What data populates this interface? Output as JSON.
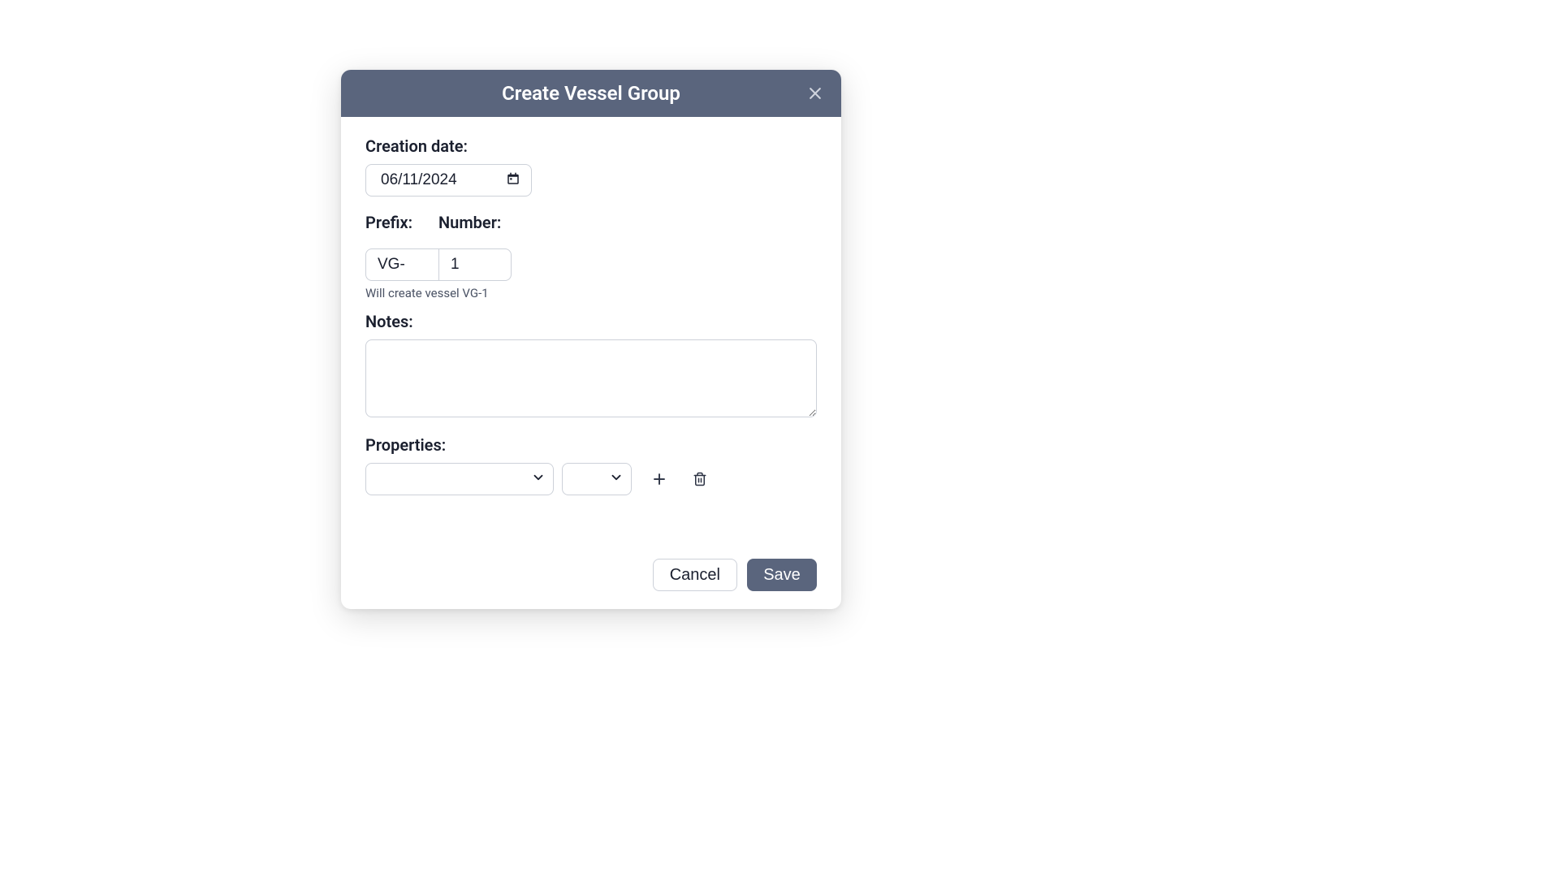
{
  "modal": {
    "title": "Create Vessel Group",
    "labels": {
      "creation_date": "Creation date:",
      "prefix": "Prefix:",
      "number": "Number:",
      "notes": "Notes:",
      "properties": "Properties:"
    },
    "fields": {
      "creation_date": "06/11/2024",
      "prefix": "VG-",
      "number": "1",
      "notes": "",
      "property_key": "",
      "property_value": ""
    },
    "hint": "Will create vessel VG-1",
    "buttons": {
      "cancel": "Cancel",
      "save": "Save"
    }
  },
  "colors": {
    "header_bg": "#5a657d",
    "primary": "#5a657d",
    "border": "#cdd1d9",
    "text": "#1a1f2e",
    "hint": "#4a5264"
  }
}
